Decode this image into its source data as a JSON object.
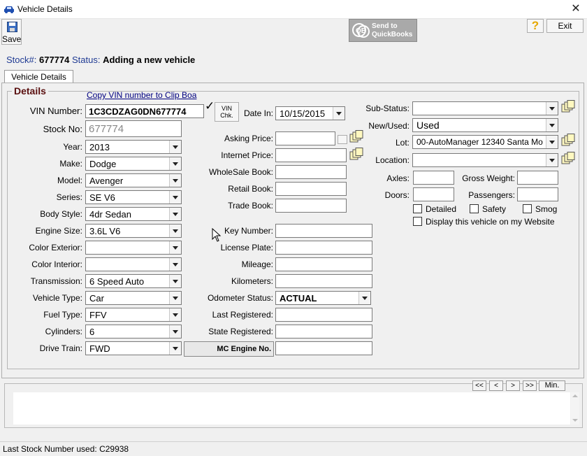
{
  "window": {
    "title": "Vehicle Details",
    "close_symbol": "✕"
  },
  "toolbar": {
    "save_label": "Save",
    "qb_line1": "Send to",
    "qb_line2": "QuickBooks",
    "help_label": "?",
    "exit_label": "Exit"
  },
  "header": {
    "stock_prefix": "Stock#:",
    "stock_value": "677774",
    "status_prefix": "Status:",
    "status_value": "Adding a new vehicle"
  },
  "tabs": [
    {
      "label": "Vehicle Details"
    }
  ],
  "details": {
    "legend": "Details",
    "copy_vin_link": "Copy VIN number to Clip Boa",
    "vin_check_line1": "VIN",
    "vin_check_line2": "Chk.",
    "left": [
      {
        "label": "VIN Number:",
        "value": "1C3CDZAG0DN677774"
      },
      {
        "label": "Stock No:",
        "value": "677774"
      },
      {
        "label": "Year:",
        "value": "2013"
      },
      {
        "label": "Make:",
        "value": "Dodge"
      },
      {
        "label": "Model:",
        "value": "Avenger"
      },
      {
        "label": "Series:",
        "value": "SE V6"
      },
      {
        "label": "Body Style:",
        "value": "4dr Sedan"
      },
      {
        "label": "Engine Size:",
        "value": "3.6L V6"
      },
      {
        "label": "Color Exterior:",
        "value": ""
      },
      {
        "label": "Color Interior:",
        "value": ""
      },
      {
        "label": "Transmission:",
        "value": "6 Speed Auto"
      },
      {
        "label": "Vehicle Type:",
        "value": "Car"
      },
      {
        "label": "Fuel Type:",
        "value": "FFV"
      },
      {
        "label": "Cylinders:",
        "value": "6"
      },
      {
        "label": "Drive Train:",
        "value": "FWD"
      }
    ],
    "date_in": {
      "label": "Date In:",
      "value": "10/15/2015"
    },
    "prices": [
      {
        "label": "Asking Price:",
        "value": ""
      },
      {
        "label": "Internet Price:",
        "value": ""
      },
      {
        "label": "WholeSale Book:",
        "value": ""
      },
      {
        "label": "Retail Book:",
        "value": ""
      },
      {
        "label": "Trade Book:",
        "value": ""
      }
    ],
    "middle": [
      {
        "label": "Key Number:",
        "value": ""
      },
      {
        "label": "License Plate:",
        "value": ""
      },
      {
        "label": "Mileage:",
        "value": ""
      },
      {
        "label": "Kilometers:",
        "value": ""
      },
      {
        "label": "Odometer Status:",
        "value": "ACTUAL"
      },
      {
        "label": "Last Registered:",
        "value": ""
      },
      {
        "label": "State Registered:",
        "value": ""
      },
      {
        "label": "MC Engine No.",
        "value": ""
      }
    ],
    "right": {
      "sub_status": {
        "label": "Sub-Status:",
        "value": ""
      },
      "new_used": {
        "label": "New/Used:",
        "value": "Used"
      },
      "lot": {
        "label": "Lot:",
        "value": "00-AutoManager 12340 Santa Mo"
      },
      "location": {
        "label": "Location:",
        "value": ""
      },
      "axles": {
        "label": "Axles:",
        "value": ""
      },
      "gross_weight": {
        "label": "Gross Weight:",
        "value": ""
      },
      "doors": {
        "label": "Doors:",
        "value": ""
      },
      "passengers": {
        "label": "Passengers:",
        "value": ""
      },
      "checkboxes": [
        {
          "label": "Detailed",
          "checked": false
        },
        {
          "label": "Safety",
          "checked": false
        },
        {
          "label": "Smog",
          "checked": false
        },
        {
          "label": "Display this vehicle on my Website",
          "checked": false
        }
      ]
    }
  },
  "notes_nav": {
    "first": "<<",
    "prev": "<",
    "next": ">",
    "last": ">>",
    "min": "Min."
  },
  "status_bar": {
    "text": "Last Stock Number used: C29938"
  },
  "colors": {
    "legend_text": "#5a1010",
    "link": "#000080",
    "header_blue": "#1f3a93"
  }
}
